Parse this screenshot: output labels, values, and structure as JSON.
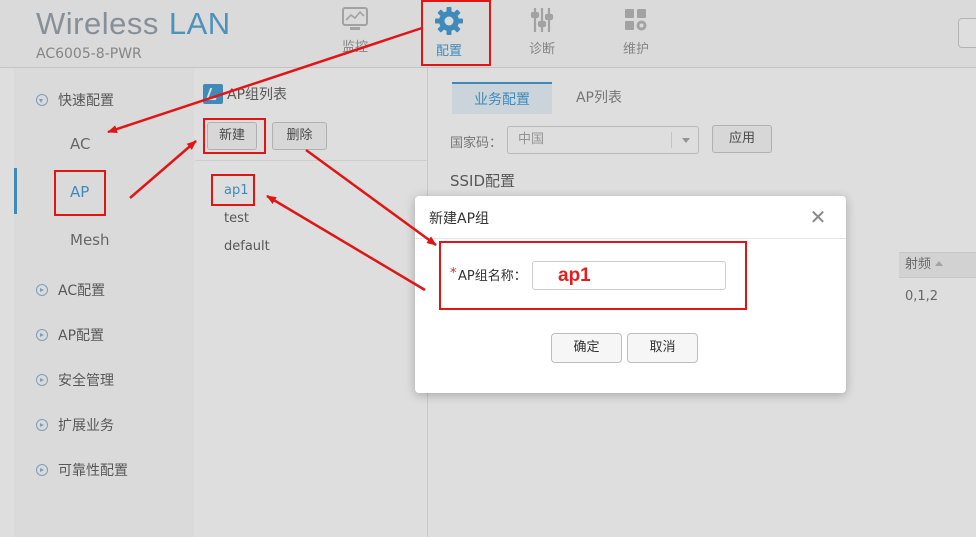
{
  "header": {
    "brand_word1": "Wireless",
    "brand_word2": "LAN",
    "model": "AC6005-8-PWR",
    "nav": [
      {
        "label": "监控",
        "icon": "monitor-icon"
      },
      {
        "label": "配置",
        "icon": "gear-icon",
        "active": true
      },
      {
        "label": "诊断",
        "icon": "sliders-icon"
      },
      {
        "label": "维护",
        "icon": "tools-icon"
      }
    ]
  },
  "sidebar": {
    "groups": [
      {
        "label": "快速配置",
        "expanded": true
      },
      {
        "label": "AC配置"
      },
      {
        "label": "AP配置"
      },
      {
        "label": "安全管理"
      },
      {
        "label": "扩展业务"
      },
      {
        "label": "可靠性配置"
      }
    ],
    "sub_items": [
      "AC",
      "AP",
      "Mesh"
    ],
    "selected_sub": "AP"
  },
  "ap_group": {
    "title": "AP组列表",
    "new_button": "新建",
    "delete_button": "删除",
    "items": [
      "ap1",
      "test",
      "default"
    ],
    "selected": "ap1"
  },
  "main": {
    "tabs": [
      "业务配置",
      "AP列表"
    ],
    "active_tab": "业务配置",
    "country_label": "国家码：",
    "country_value": "中国",
    "apply_button": "应用",
    "ssid_title": "SSID配置",
    "column_header": "射频",
    "column_value": "0,1,2"
  },
  "dialog": {
    "title": "新建AP组",
    "close_glyph": "✕",
    "required_mark": "*",
    "field_label": "AP组名称：",
    "field_value": "ap1",
    "ok_button": "确定",
    "cancel_button": "取消"
  },
  "colors": {
    "accent": "#4a9fd6",
    "annotation": "#e01616"
  }
}
